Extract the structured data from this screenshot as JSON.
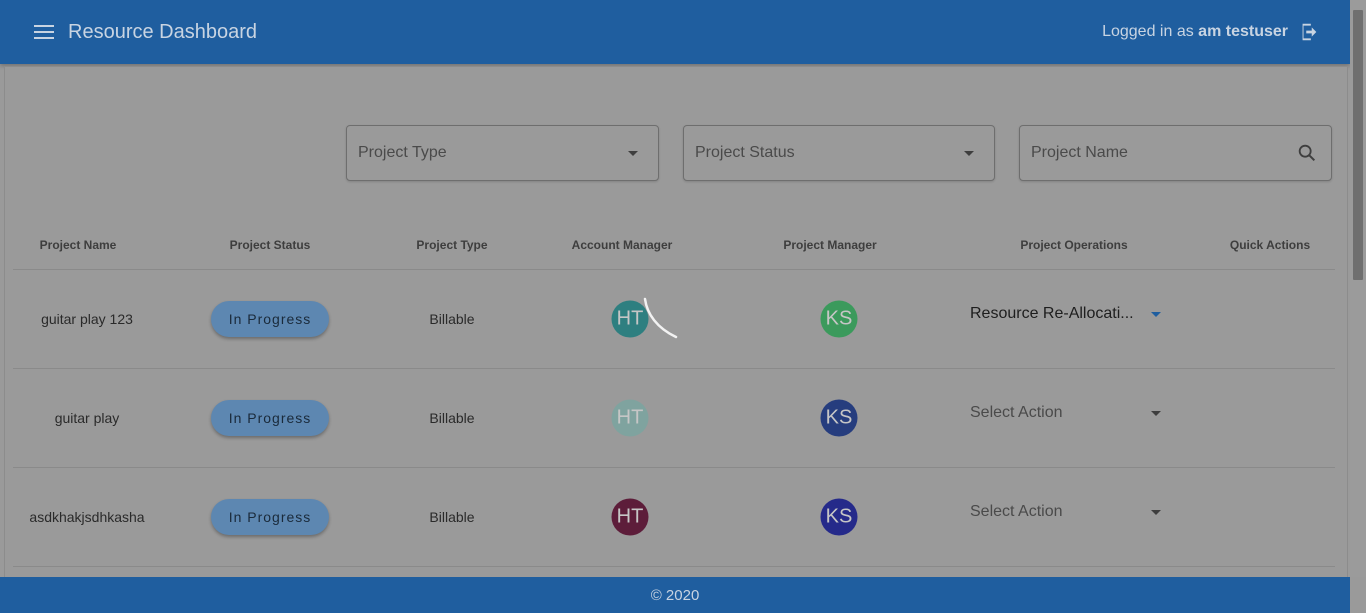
{
  "header": {
    "title": "Resource Dashboard",
    "login_prefix": "Logged in as",
    "user_name": "am testuser"
  },
  "filters": {
    "project_type": "Project Type",
    "project_status": "Project Status",
    "project_name": "Project Name"
  },
  "table": {
    "columns": [
      "Project Name",
      "Project Status",
      "Project Type",
      "Account Manager",
      "Project Manager",
      "Project Operations",
      "Quick Actions"
    ],
    "rows": [
      {
        "name": "guitar play 123",
        "status": "In Progress",
        "type": "Billable",
        "account_manager": {
          "initials": "HT",
          "color": "#2e7f80"
        },
        "project_manager": {
          "initials": "KS",
          "color": "#3b9a5c"
        },
        "operation": "Resource Re-Allocati...",
        "operation_color": "#1e1e1e",
        "caret_color": "#1f5e9f"
      },
      {
        "name": "guitar play",
        "status": "In Progress",
        "type": "Billable",
        "account_manager": {
          "initials": "HT",
          "color": "#7fa39f"
        },
        "project_manager": {
          "initials": "KS",
          "color": "#263d7e"
        },
        "operation": "Select Action",
        "operation_color": "#4a4a4a",
        "caret_color": "#3e3e3e"
      },
      {
        "name": "asdkhakjsdhkasha",
        "status": "In Progress",
        "type": "Billable",
        "account_manager": {
          "initials": "HT",
          "color": "#5d1d3a"
        },
        "project_manager": {
          "initials": "KS",
          "color": "#252a8a"
        },
        "operation": "Select Action",
        "operation_color": "#4a4a4a",
        "caret_color": "#3e3e3e"
      }
    ]
  },
  "footer": {
    "text": "© 2020"
  },
  "colors": {
    "app_bar": "#1f5e9f",
    "status_button": "#5d87b1"
  }
}
